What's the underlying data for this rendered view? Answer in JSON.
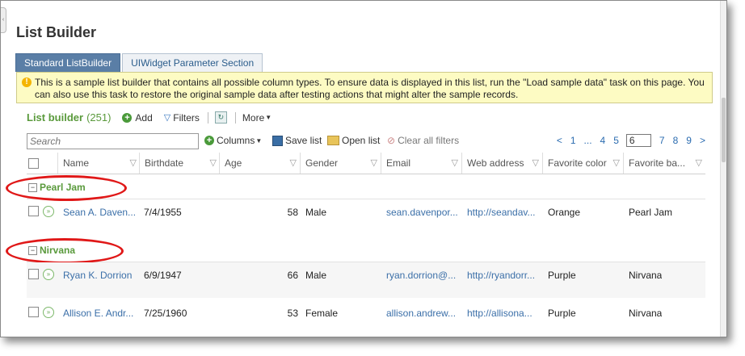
{
  "page": {
    "title": "List Builder"
  },
  "tabs": [
    {
      "label": "Standard ListBuilder",
      "active": true
    },
    {
      "label": "UIWidget Parameter Section",
      "active": false
    }
  ],
  "notice": {
    "line1": "This is a sample list builder that contains all possible column types. To ensure data is displayed in this list, run the \"Load sample data\" task on this page. You",
    "line2": "can also use this task to restore the original sample data after testing actions that might alter the sample records."
  },
  "list": {
    "title": "List builder",
    "count": "(251)",
    "add_label": "Add",
    "filters_label": "Filters",
    "more_label": "More"
  },
  "toolbar": {
    "search_placeholder": "Search",
    "columns_label": "Columns",
    "save_list_label": "Save list",
    "open_list_label": "Open list",
    "clear_filters_label": "Clear all filters"
  },
  "pager": {
    "prev": "<",
    "pages_before": [
      "1",
      "...",
      "4",
      "5"
    ],
    "current": "6",
    "pages_after": [
      "7",
      "8",
      "9"
    ],
    "next": ">"
  },
  "columns": [
    "Name",
    "Birthdate",
    "Age",
    "Gender",
    "Email",
    "Web address",
    "Favorite color",
    "Favorite ba..."
  ],
  "groups": [
    {
      "name": "Pearl Jam",
      "rows": [
        {
          "name": "Sean A. Daven...",
          "birthdate": "7/4/1955",
          "age": "58",
          "gender": "Male",
          "email": "sean.davenpor...",
          "web": "http://seandav...",
          "color": "Orange",
          "band": "Pearl Jam"
        }
      ]
    },
    {
      "name": "Nirvana",
      "rows": [
        {
          "name": "Ryan K. Dorrion",
          "birthdate": "6/9/1947",
          "age": "66",
          "gender": "Male",
          "email": "ryan.dorrion@...",
          "web": "http://ryandorr...",
          "color": "Purple",
          "band": "Nirvana"
        },
        {
          "name": "Allison E. Andr...",
          "birthdate": "7/25/1960",
          "age": "53",
          "gender": "Female",
          "email": "allison.andrew...",
          "web": "http://allisona...",
          "color": "Purple",
          "band": "Nirvana"
        }
      ]
    }
  ],
  "colors": {
    "accent_green": "#5a9a3c",
    "link_blue": "#3b6fa8",
    "tab_active": "#5a7ea6",
    "notice_bg": "#fdfbc3",
    "highlight_red": "#e01818"
  }
}
